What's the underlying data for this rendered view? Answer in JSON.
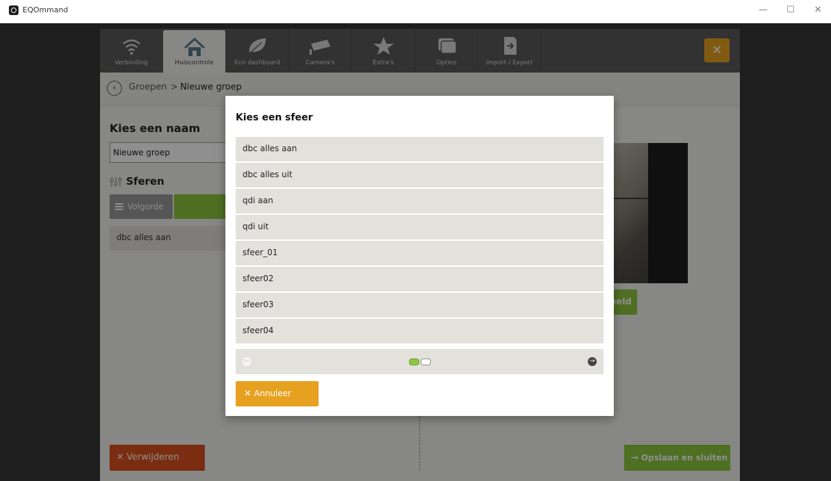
{
  "window": {
    "title": "EQOmmand",
    "minimize": "—",
    "maximize": "☐",
    "close": "✕"
  },
  "nav": {
    "tabs": [
      {
        "label": "Verbinding",
        "icon": "wifi-icon"
      },
      {
        "label": "Huiscontrole",
        "icon": "house-icon",
        "active": true
      },
      {
        "label": "Eco dashboard",
        "icon": "leaf-icon"
      },
      {
        "label": "Camera's",
        "icon": "camera-icon"
      },
      {
        "label": "Extra's",
        "icon": "star-icon"
      },
      {
        "label": "Opties",
        "icon": "windows-icon"
      },
      {
        "label": "Import / Export",
        "icon": "import-export-icon"
      }
    ],
    "close_symbol": "✕"
  },
  "breadcrumb": {
    "back_symbol": "‹",
    "parent": "Groepen",
    "separator": ">",
    "current": "Nieuwe groep"
  },
  "form": {
    "name_label": "Kies een naam",
    "name_value": "Nieuwe groep",
    "sferen_label": "Sferen",
    "volgorde_label": "Volgorde",
    "items": [
      "dbc alles aan"
    ]
  },
  "right_panel": {
    "button_fragment": "eeld"
  },
  "footer": {
    "delete_label": "Verwijderen",
    "save_label": "Opslaan en sluiten"
  },
  "modal": {
    "title": "Kies een sfeer",
    "options": [
      "dbc alles aan",
      "dbc alles uit",
      "qdi aan",
      "qdi uit",
      "sfeer_01",
      "sfeer02",
      "sfeer03",
      "sfeer04"
    ],
    "pager": {
      "prev_symbol": "←",
      "next_symbol": "→",
      "pages": 2,
      "current_page": 1
    },
    "cancel_label": "Annuleer"
  },
  "colors": {
    "accent_orange": "#e6a120",
    "accent_green": "#8dc63f",
    "danger_red": "#d9501e",
    "nav_bg": "#5a5a5a"
  }
}
